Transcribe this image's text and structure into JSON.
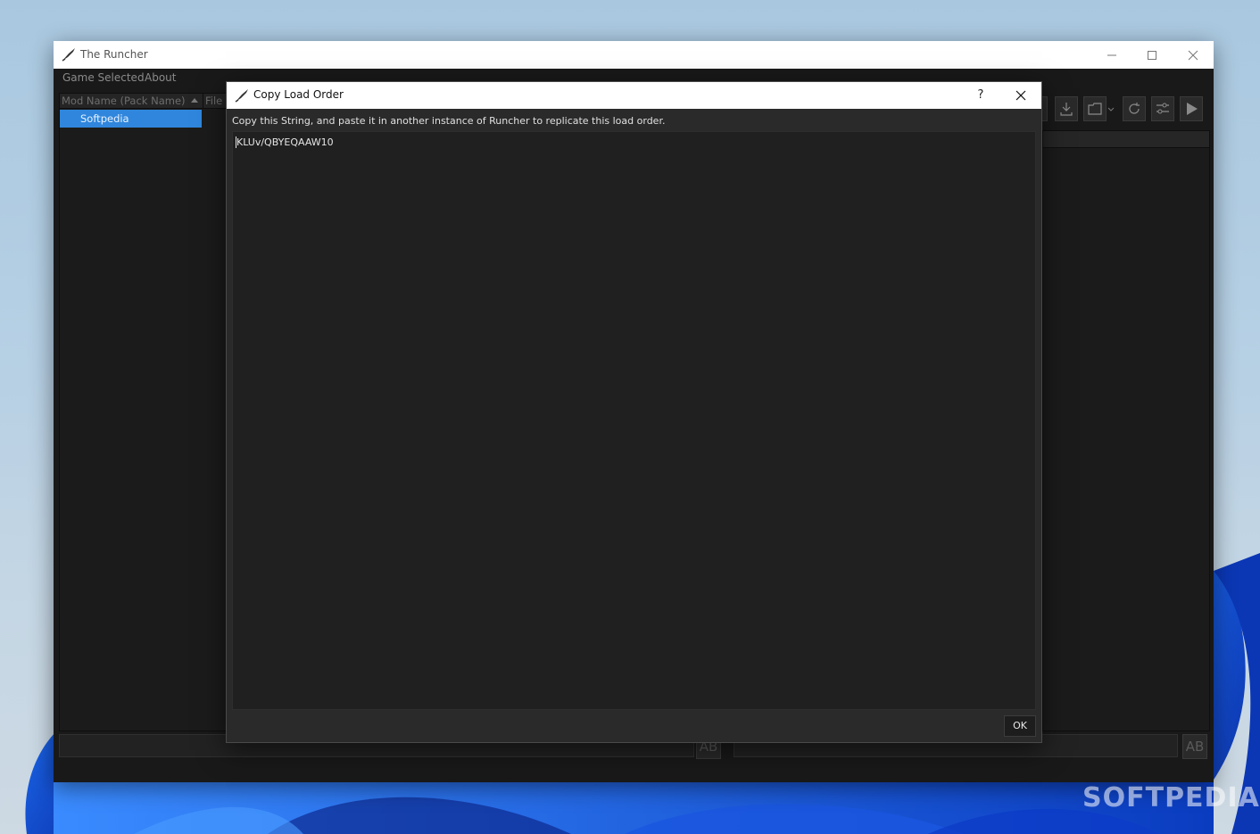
{
  "window": {
    "title": "The Runcher",
    "controls": [
      "minimize-icon",
      "maximize-icon",
      "close-icon"
    ]
  },
  "menu": {
    "items": [
      "Game Selected",
      "About"
    ]
  },
  "mod_list": {
    "columns": [
      "Mod Name (Pack Name)",
      "File S"
    ],
    "rows": [
      {
        "name": "Softpedia",
        "selected": true
      }
    ]
  },
  "toolbar": {
    "icons": [
      "download-icon",
      "folder-icon",
      "refresh-icon",
      "settings-sliders-icon",
      "play-icon"
    ]
  },
  "bottom_bar": {
    "ab_left": "AB",
    "ab_right": "AB"
  },
  "dialog": {
    "title": "Copy Load Order",
    "help_label": "?",
    "description": "Copy this String, and paste it in another instance of Runcher to replicate this load order.",
    "load_order_string": "KLUv/QBYEQAAW10",
    "ok_label": "OK"
  },
  "watermark": "SOFTPEDIA",
  "colors": {
    "selection": "#2f86dc",
    "dialog_bg": "#2a2a2a",
    "text_area_bg": "#202020",
    "window_bg": "#191919"
  }
}
